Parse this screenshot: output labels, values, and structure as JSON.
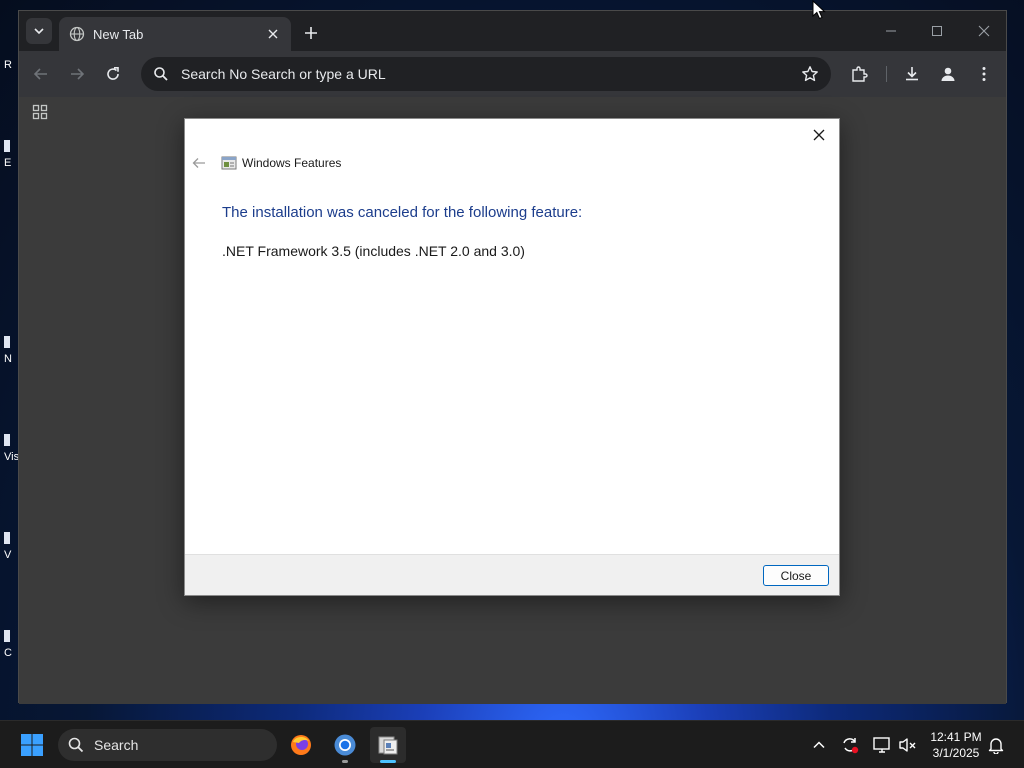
{
  "browser": {
    "tab": {
      "title": "New Tab"
    },
    "omnibox": {
      "placeholder": "Search No Search or type a URL"
    }
  },
  "dialog": {
    "app_title": "Windows Features",
    "heading": "The installation was canceled for the following feature:",
    "feature": ".NET Framework 3.5 (includes .NET 2.0 and 3.0)",
    "close_button": "Close"
  },
  "desktop": {
    "icon_labels": [
      "R",
      "E",
      "N",
      "Vis",
      "V",
      "C"
    ]
  },
  "taskbar": {
    "search_label": "Search",
    "clock": {
      "time": "12:41 PM",
      "date": "3/1/2025"
    }
  },
  "colors": {
    "dialog_heading": "#1c3d8c",
    "button_border": "#0067c0",
    "browser_frame": "#202124",
    "browser_toolbar": "#35363a",
    "page_background": "#3b3b3b"
  }
}
